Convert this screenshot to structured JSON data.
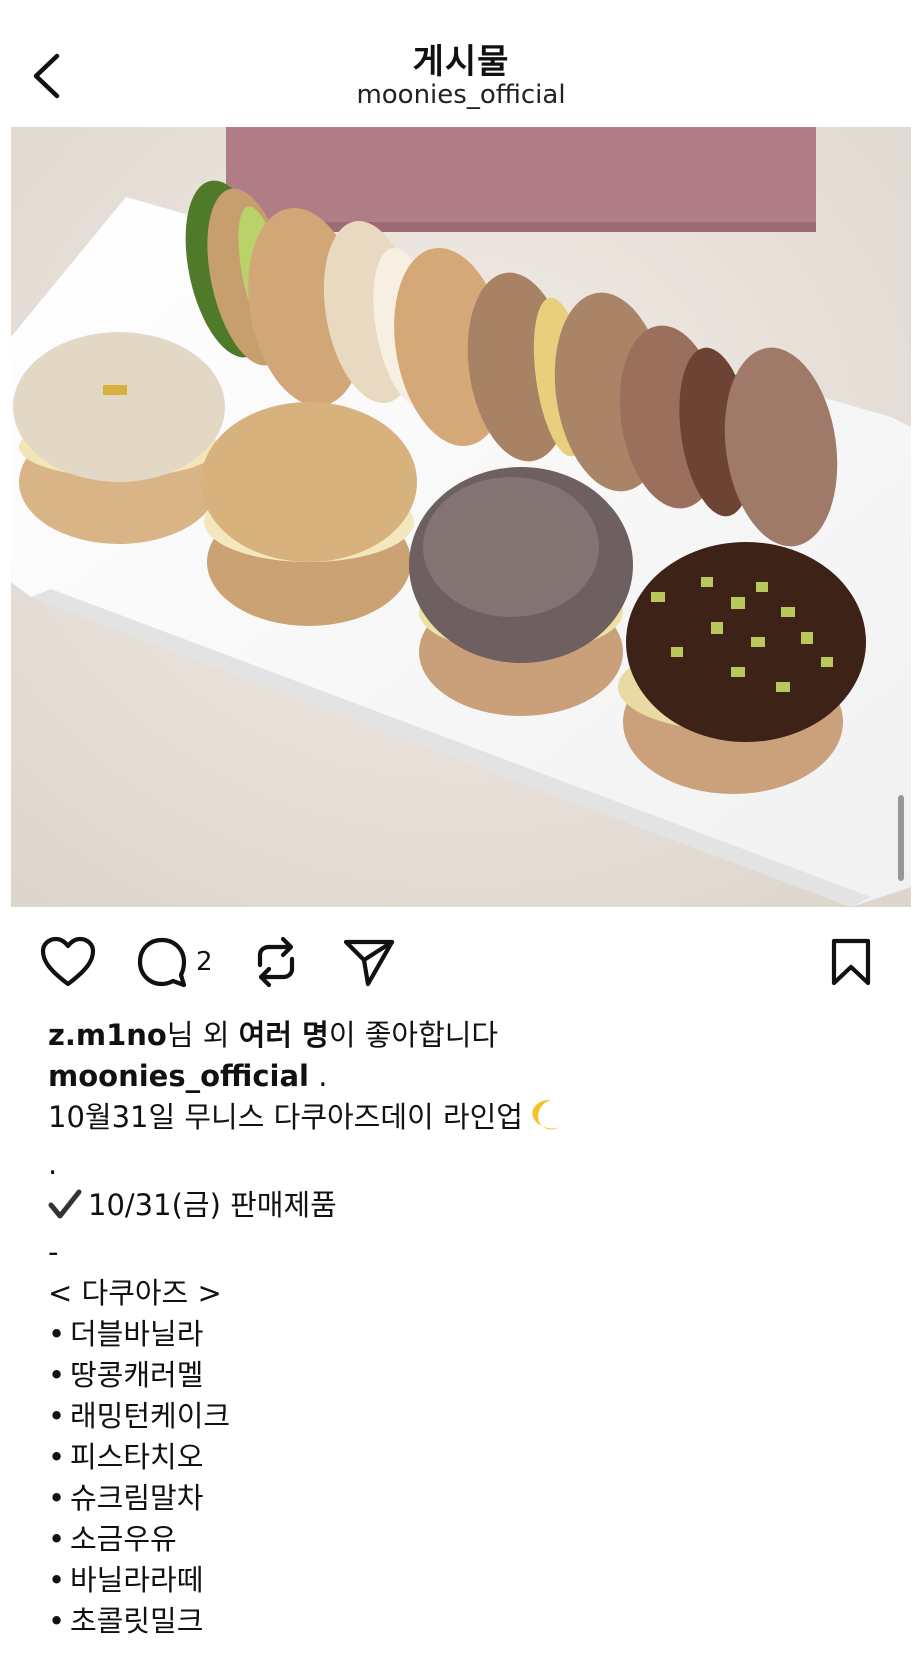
{
  "header": {
    "title": "게시물",
    "username": "moonies_official"
  },
  "post": {
    "image_alt": "Tray of dacquoise sandwich cookies",
    "comment_count": "2",
    "likes": {
      "user": "z.m1no",
      "mid1": "님 외 ",
      "others": "여러 명",
      "tail": "이 좋아합니다"
    },
    "caption": {
      "author": "moonies_official",
      "author_tail": " .",
      "line1": "10월31일 무니스 다쿠아즈데이 라인업",
      "dot": ".",
      "check_line": "10/31(금) 판매제품",
      "dash": "-",
      "section": "< 다쿠아즈 >",
      "items": [
        "더블바닐라",
        "땅콩캐러멜",
        "래밍턴케이크",
        "피스타치오",
        "슈크림말차",
        "소금우유",
        "바닐라라떼",
        "초콜릿밀크"
      ],
      "bullet": "•"
    }
  },
  "colors": {
    "text": "#111111",
    "background": "#ffffff"
  }
}
